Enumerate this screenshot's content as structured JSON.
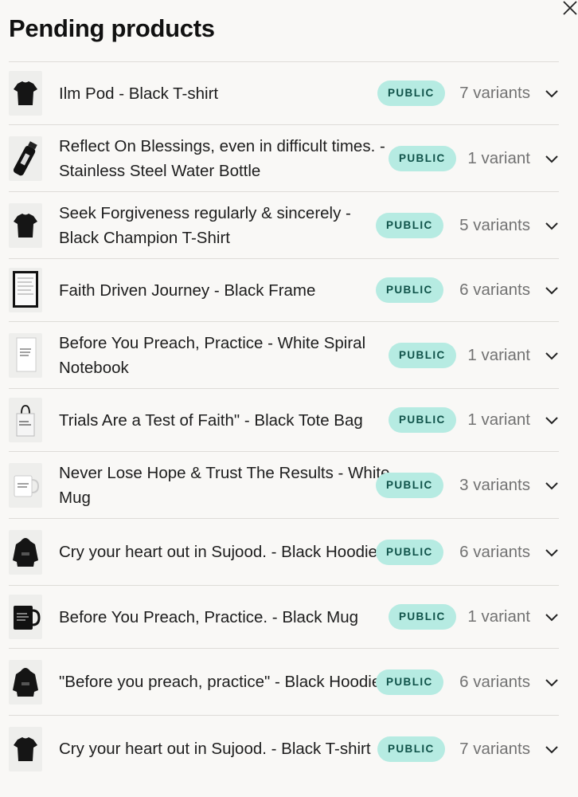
{
  "title": "Pending products",
  "items": [
    {
      "name": "Ilm Pod - Black T-shirt",
      "status": "PUBLIC",
      "variants": "7 variants",
      "thumb": "tshirt-icon"
    },
    {
      "name": "Reflect On Blessings, even in difficult times. - Stainless Steel Water Bottle",
      "status": "PUBLIC",
      "variants": "1 variant",
      "thumb": "bottle-icon"
    },
    {
      "name": "Seek Forgiveness regularly & sincerely - Black Champion T-Shirt",
      "status": "PUBLIC",
      "variants": "5 variants",
      "thumb": "tshirt-icon"
    },
    {
      "name": "Faith Driven Journey - Black Frame",
      "status": "PUBLIC",
      "variants": "6 variants",
      "thumb": "frame-icon"
    },
    {
      "name": "Before You Preach, Practice - White Spiral Notebook",
      "status": "PUBLIC",
      "variants": "1 variant",
      "thumb": "notebook-icon"
    },
    {
      "name": "Trials Are a Test of Faith\" - Black Tote Bag",
      "status": "PUBLIC",
      "variants": "1 variant",
      "thumb": "tote-bag-icon"
    },
    {
      "name": "Never Lose Hope & Trust The Results - White Mug",
      "status": "PUBLIC",
      "variants": "3 variants",
      "thumb": "white-mug-icon"
    },
    {
      "name": "Cry your heart out in Sujood. - Black Hoodie",
      "status": "PUBLIC",
      "variants": "6 variants",
      "thumb": "hoodie-icon"
    },
    {
      "name": "Before You Preach, Practice. - Black Mug",
      "status": "PUBLIC",
      "variants": "1 variant",
      "thumb": "black-mug-icon"
    },
    {
      "name": "\"Before you preach, practice\" - Black Hoodie",
      "status": "PUBLIC",
      "variants": "6 variants",
      "thumb": "hoodie-icon"
    },
    {
      "name": "Cry your heart out in Sujood. - Black T-shirt",
      "status": "PUBLIC",
      "variants": "7 variants",
      "thumb": "tshirt-icon"
    }
  ]
}
